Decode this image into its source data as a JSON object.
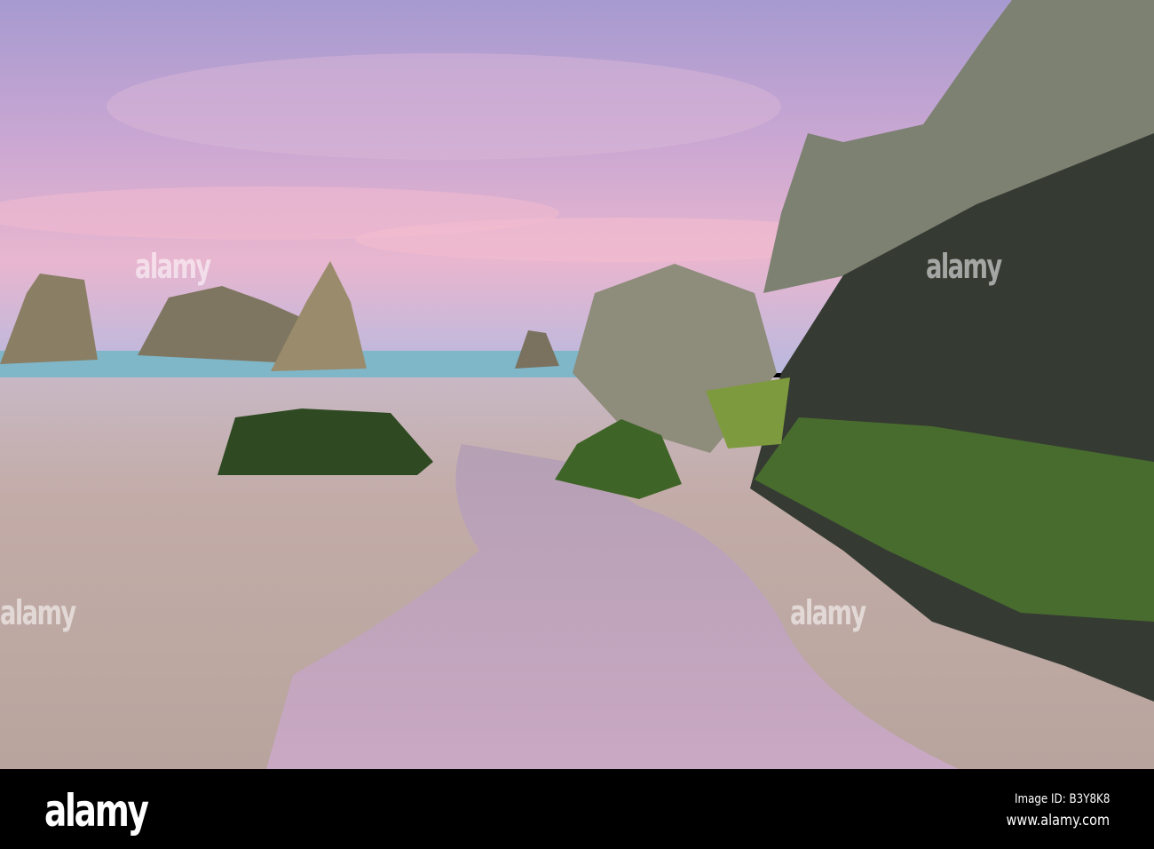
{
  "watermark": {
    "text": "alamy"
  },
  "footer": {
    "logo": "alamy",
    "image_id": "Image ID: B3Y8K8",
    "website": "www.alamy.com"
  },
  "colors": {
    "sky_pink": "#e7b3d0",
    "sky_blue": "#9aa6d6",
    "sand": "#c9b4ae",
    "moss": "#4e7a2c",
    "rock": "#3a3c38"
  }
}
